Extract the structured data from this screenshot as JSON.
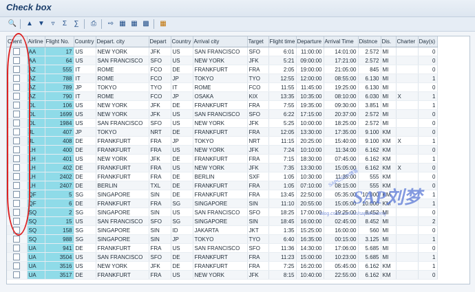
{
  "title": "Check box",
  "toolbar": {
    "buttons": [
      "details",
      "sort-ascending",
      "sort-descending",
      "filter",
      "sum",
      "subtotal",
      "print",
      "export",
      "spreadsheet",
      "change-layout",
      "select-layout",
      "grid-options"
    ]
  },
  "columns": [
    "Client",
    "Airline",
    "Flight No.",
    "Country",
    "Depart. city",
    "Depart",
    "Country",
    "Arrival city",
    "Target",
    "Flight time",
    "Departure",
    "Arrival Time",
    "Distnce",
    "Dis.",
    "Charter",
    "Day(s)"
  ],
  "rows": [
    [
      "",
      "AA",
      "17",
      "US",
      "NEW YORK",
      "JFK",
      "US",
      "SAN FRANCISCO",
      "SFO",
      "6:01",
      "11:00:00",
      "14:01:00",
      "2.572",
      "MI",
      "",
      "0"
    ],
    [
      "",
      "AA",
      "64",
      "US",
      "SAN FRANCISCO",
      "SFO",
      "US",
      "NEW YORK",
      "JFK",
      "5:21",
      "09:00:00",
      "17:21:00",
      "2.572",
      "MI",
      "",
      "0"
    ],
    [
      "",
      "AZ",
      "555",
      "IT",
      "ROME",
      "FCO",
      "DE",
      "FRANKFURT",
      "FRA",
      "2:05",
      "19:00:00",
      "21:05:00",
      "845",
      "MI",
      "",
      "0"
    ],
    [
      "",
      "AZ",
      "788",
      "IT",
      "ROME",
      "FCO",
      "JP",
      "TOKYO",
      "TYO",
      "12:55",
      "12:00:00",
      "08:55:00",
      "6.130",
      "MI",
      "",
      "1"
    ],
    [
      "",
      "AZ",
      "789",
      "JP",
      "TOKYO",
      "TYO",
      "IT",
      "ROME",
      "FCO",
      "11:55",
      "11:45:00",
      "19:25:00",
      "6.130",
      "MI",
      "",
      "0"
    ],
    [
      "",
      "AZ",
      "790",
      "IT",
      "ROME",
      "FCO",
      "JP",
      "OSAKA",
      "KIX",
      "13:35",
      "10:35:00",
      "08:10:00",
      "6.030",
      "MI",
      "X",
      "1"
    ],
    [
      "",
      "DL",
      "106",
      "US",
      "NEW YORK",
      "JFK",
      "DE",
      "FRANKFURT",
      "FRA",
      "7:55",
      "19:35:00",
      "09:30:00",
      "3.851",
      "MI",
      "",
      "1"
    ],
    [
      "",
      "DL",
      "1699",
      "US",
      "NEW YORK",
      "JFK",
      "US",
      "SAN FRANCISCO",
      "SFO",
      "6:22",
      "17:15:00",
      "20:37:00",
      "2.572",
      "MI",
      "",
      "0"
    ],
    [
      "",
      "DL",
      "1984",
      "US",
      "SAN FRANCISCO",
      "SFO",
      "US",
      "NEW YORK",
      "JFK",
      "5:25",
      "10:00:00",
      "18:25:00",
      "2.572",
      "MI",
      "",
      "0"
    ],
    [
      "",
      "JL",
      "407",
      "JP",
      "TOKYO",
      "NRT",
      "DE",
      "FRANKFURT",
      "FRA",
      "12:05",
      "13:30:00",
      "17:35:00",
      "9.100",
      "KM",
      "",
      "0"
    ],
    [
      "",
      "JL",
      "408",
      "DE",
      "FRANKFURT",
      "FRA",
      "JP",
      "TOKYO",
      "NRT",
      "11:15",
      "20:25:00",
      "15:40:00",
      "9.100",
      "KM",
      "X",
      "1"
    ],
    [
      "",
      "LH",
      "400",
      "DE",
      "FRANKFURT",
      "FRA",
      "US",
      "NEW YORK",
      "JFK",
      "7:24",
      "10:10:00",
      "11:34:00",
      "6.162",
      "KM",
      "",
      "0"
    ],
    [
      "",
      "LH",
      "401",
      "US",
      "NEW YORK",
      "JFK",
      "DE",
      "FRANKFURT",
      "FRA",
      "7:15",
      "18:30:00",
      "07:45:00",
      "6.162",
      "KM",
      "",
      "1"
    ],
    [
      "",
      "LH",
      "402",
      "DE",
      "FRANKFURT",
      "FRA",
      "US",
      "NEW YORK",
      "JFK",
      "7:35",
      "13:30:00",
      "15:05:00",
      "6.162",
      "KM",
      "X",
      "0"
    ],
    [
      "",
      "LH",
      "2402",
      "DE",
      "FRANKFURT",
      "FRA",
      "DE",
      "BERLIN",
      "SXF",
      "1:05",
      "10:30:00",
      "11:35:00",
      "555",
      "KM",
      "",
      "0"
    ],
    [
      "",
      "LH",
      "2407",
      "DE",
      "BERLIN",
      "TXL",
      "DE",
      "FRANKFURT",
      "FRA",
      "1:05",
      "07:10:00",
      "08:15:00",
      "555",
      "KM",
      "",
      "0"
    ],
    [
      "",
      "QF",
      "5",
      "SG",
      "SINGAPORE",
      "SIN",
      "DE",
      "FRANKFURT",
      "FRA",
      "13:45",
      "22:50:00",
      "05:35:00",
      "10.000",
      "KM",
      "",
      "1"
    ],
    [
      "",
      "QF",
      "6",
      "DE",
      "FRANKFURT",
      "FRA",
      "SG",
      "SINGAPORE",
      "SIN",
      "11:10",
      "20:55:00",
      "15:05:00",
      "10.000",
      "KM",
      "",
      "1"
    ],
    [
      "",
      "SQ",
      "2",
      "SG",
      "SINGAPORE",
      "SIN",
      "US",
      "SAN FRANCISCO",
      "SFO",
      "18:25",
      "17:00:00",
      "19:25:00",
      "8.452",
      "MI",
      "",
      "0"
    ],
    [
      "",
      "SQ",
      "15",
      "US",
      "SAN FRANCISCO",
      "SFO",
      "SG",
      "SINGAPORE",
      "SIN",
      "18:45",
      "16:00:00",
      "02:45:00",
      "8.452",
      "MI",
      "",
      "2"
    ],
    [
      "",
      "SQ",
      "158",
      "SG",
      "SINGAPORE",
      "SIN",
      "ID",
      "JAKARTA",
      "JKT",
      "1:35",
      "15:25:00",
      "16:00:00",
      "560",
      "MI",
      "",
      "0"
    ],
    [
      "",
      "SQ",
      "988",
      "SG",
      "SINGAPORE",
      "SIN",
      "JP",
      "TOKYO",
      "TYO",
      "6:40",
      "16:35:00",
      "00:15:00",
      "3.125",
      "MI",
      "",
      "1"
    ],
    [
      "",
      "UA",
      "941",
      "DE",
      "FRANKFURT",
      "FRA",
      "US",
      "SAN FRANCISCO",
      "SFO",
      "11:36",
      "14:30:00",
      "17:06:00",
      "5.685",
      "MI",
      "",
      "0"
    ],
    [
      "",
      "UA",
      "3504",
      "US",
      "SAN FRANCISCO",
      "SFO",
      "DE",
      "FRANKFURT",
      "FRA",
      "11:23",
      "15:00:00",
      "10:23:00",
      "5.685",
      "MI",
      "",
      "1"
    ],
    [
      "",
      "UA",
      "3516",
      "US",
      "NEW YORK",
      "JFK",
      "DE",
      "FRANKFURT",
      "FRA",
      "7:25",
      "16:20:00",
      "05:45:00",
      "6.162",
      "KM",
      "",
      "1"
    ],
    [
      "",
      "UA",
      "3517",
      "DE",
      "FRANKFURT",
      "FRA",
      "US",
      "NEW YORK",
      "JFK",
      "8:15",
      "10:40:00",
      "22:55:00",
      "6.162",
      "KM",
      "",
      "0"
    ]
  ],
  "watermark": {
    "text": "SAP刘梦",
    "url": "blog.csdn.com.cn/saptiliumeng",
    "arc": "SAPCSDN博客"
  }
}
